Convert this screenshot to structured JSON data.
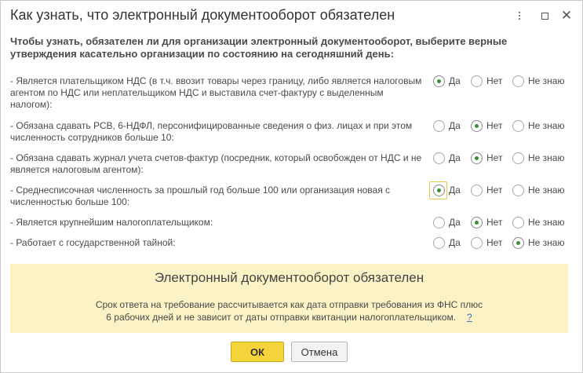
{
  "window": {
    "title": "Как узнать, что электронный документооборот обязателен"
  },
  "intro": "Чтобы узнать, обязателен ли для организации электронный документооборот, выберите верные утверждения касательно организации по состоянию на сегодняшний день:",
  "options": {
    "yes": "Да",
    "no": "Нет",
    "unknown": "Не знаю"
  },
  "questions": [
    {
      "text": "- Является плательщиком НДС (в т.ч. ввозит товары через границу, либо является налоговым агентом по НДС или неплательщиком НДС и выставила счет-фактуру с выделенным налогом):",
      "selected": "yes"
    },
    {
      "text": "- Обязана сдавать РСВ, 6-НДФЛ, персонифицированные сведения о физ. лицах и при этом численность сотрудников больше 10:",
      "selected": "no"
    },
    {
      "text": "- Обязана сдавать журнал учета счетов-фактур (посредник, который освобожден от НДС и не является налоговым агентом):",
      "selected": "no"
    },
    {
      "text": "- Среднесписочная численность за прошлый год больше 100 или организация новая с численностью больше 100:",
      "selected": "yes"
    },
    {
      "text": "- Является крупнейшим налогоплательщиком:",
      "selected": "no"
    },
    {
      "text": "- Работает с государственной тайной:",
      "selected": "unknown"
    }
  ],
  "banner": {
    "title": "Электронный документооборот обязателен",
    "line1": "Срок ответа на требование рассчитывается как дата отправки требования из ФНС плюс",
    "line2": "6 рабочих дней и не зависит от даты отправки квитанции налогоплательщиком.",
    "help": "?",
    "bg_color": "#fbf3c5"
  },
  "buttons": {
    "ok": "ОК",
    "cancel": "Отмена"
  },
  "colors": {
    "ok_button": "#f5d33a",
    "radio_checked": "#3a8f3a",
    "focus": "#e8c94a"
  }
}
